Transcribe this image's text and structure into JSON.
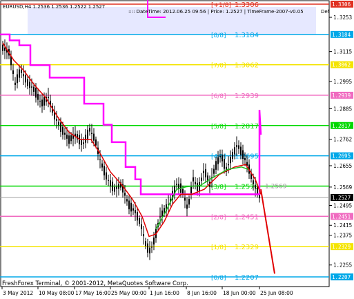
{
  "header": {
    "symbol_line": "EURUSD,H4  1.2536 1.2536 1.2522 1.2527",
    "info_line": ":::: DateTime: 2012.06.25 09:56 | Price: 1.2527 | TimeFrame-2007-v0.05",
    "def_label": "Def"
  },
  "footer": {
    "copyright": "FreshForex Terminal, © 2001-2012, MetaQuotes Software Corp."
  },
  "price_axis": {
    "current_price": "1.2527",
    "ticks": [
      "1.3306",
      "1.3253",
      "1.3184",
      "1.3115",
      "1.3062",
      "1.2995",
      "1.2939",
      "1.2885",
      "1.2817",
      "1.2762",
      "1.2695",
      "1.2655",
      "1.2569",
      "1.2527",
      "1.2495",
      "1.2451",
      "1.2415",
      "1.2375",
      "1.2329",
      "1.2255",
      "1.2207"
    ]
  },
  "time_axis": {
    "labels": [
      "3 May 2012",
      "10 May 08:00",
      "17 May 16:00",
      "25 May 00:00",
      "1 Jun 16:00",
      "8 Jun 16:00",
      "18 Jun 00:00",
      "25 Jun 08:00"
    ]
  },
  "murrey_levels": [
    {
      "label": "[8/8]",
      "value": "1.3184",
      "price": 1.3184,
      "color": "#00a8e8"
    },
    {
      "label": "[7/8]",
      "value": "1.3062",
      "price": 1.3062,
      "color": "#f4e400"
    },
    {
      "label": "[6/8]",
      "value": "1.2939",
      "price": 1.2939,
      "color": "#f06bc0"
    },
    {
      "label": "[5/8]",
      "value": "1.2817",
      "price": 1.2817,
      "color": "#00d800"
    },
    {
      "label": "[4/8]",
      "value": "1.2695",
      "price": 1.2695,
      "color": "#00a8e8"
    },
    {
      "label": "[3/8]",
      "value": "1.2573",
      "price": 1.2573,
      "color": "#00d800"
    },
    {
      "label": "[2/8]",
      "value": "1.2451",
      "price": 1.2451,
      "color": "#f06bc0"
    },
    {
      "label": "[1/8]",
      "value": "1.2329",
      "price": 1.2329,
      "color": "#f4e400"
    },
    {
      "label": "[0/8]",
      "value": "1.2207",
      "price": 1.2207,
      "color": "#00a8e8"
    }
  ],
  "extra_levels": [
    {
      "label": "[+1/8]",
      "value": "1.3306",
      "price": 1.3306,
      "color": "#e03020"
    }
  ],
  "overlay_values": {
    "mid_value": "1.2695",
    "green_line_value": "1.2569"
  },
  "colors": {
    "candles": "#000000",
    "stop_line": "#ff00ff",
    "ma_red": "#e00000",
    "ma_green": "#22c022",
    "projection": "#e00000",
    "current_price": "#000000",
    "frame_bg": "#dde0ff"
  }
}
